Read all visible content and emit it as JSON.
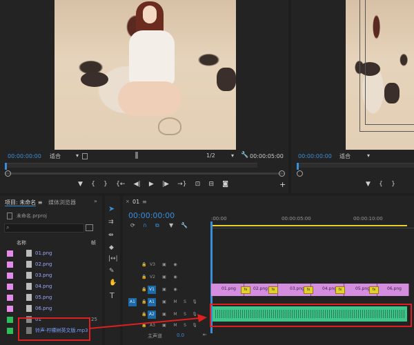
{
  "source_monitor": {
    "timecode": "00:00:00:00",
    "fit": "适合",
    "scale": "1/2",
    "duration": "00:00:05:00"
  },
  "program_monitor": {
    "timecode": "00:00:00:00",
    "fit": "适合"
  },
  "transport": {
    "marker": "▼",
    "in": "{",
    "out": "}",
    "go_in": "{←",
    "step_back": "◀|",
    "play": "▶",
    "step_fwd": "|▶",
    "go_out": "→}",
    "insert": "⊡",
    "overwrite": "⊟",
    "export_frame": "◙",
    "add": "+"
  },
  "project_panel": {
    "tab_project": "项目: 未命名",
    "tab_media": "媒体浏览器",
    "project_file": "未命名.prproj",
    "header_name": "名称",
    "header_fps": "帧",
    "items": [
      {
        "name": "01.png",
        "color": "#e58ae8"
      },
      {
        "name": "02.png",
        "color": "#e58ae8"
      },
      {
        "name": "03.png",
        "color": "#e58ae8"
      },
      {
        "name": "04.png",
        "color": "#e58ae8"
      },
      {
        "name": "05.png",
        "color": "#e58ae8"
      },
      {
        "name": "06.png",
        "color": "#e58ae8"
      },
      {
        "name": "01",
        "color": "#2cbf5a",
        "fps": "25"
      },
      {
        "name": "铃声-柠檬树英文版.mp3",
        "color": "#2cbf5a"
      }
    ]
  },
  "timeline": {
    "tab": "01",
    "timecode": "00:00:00:00",
    "ruler": [
      ":00:00",
      "00:00:05:00",
      "00:00:10:00"
    ],
    "tracks": [
      {
        "name": "V3"
      },
      {
        "name": "V2"
      },
      {
        "name": "V1",
        "src": ""
      },
      {
        "name": "A1",
        "src": "A1",
        "m": "M",
        "s": "S"
      },
      {
        "name": "A2",
        "m": "M",
        "s": "S"
      },
      {
        "name": "A3",
        "m": "M",
        "s": "S"
      }
    ],
    "master": {
      "label": "主声道",
      "value": "0.0"
    },
    "clips": [
      "01.png",
      "02.png",
      "03.png",
      "04.png",
      "05.png",
      "06.png"
    ],
    "fx": "fx"
  },
  "colors": {
    "accent_blue": "#3a8fd9",
    "clip_pink": "#d58de0",
    "audio_green": "#3fc48a",
    "highlight_red": "#e02020",
    "work_area_yellow": "#e6d22a"
  }
}
